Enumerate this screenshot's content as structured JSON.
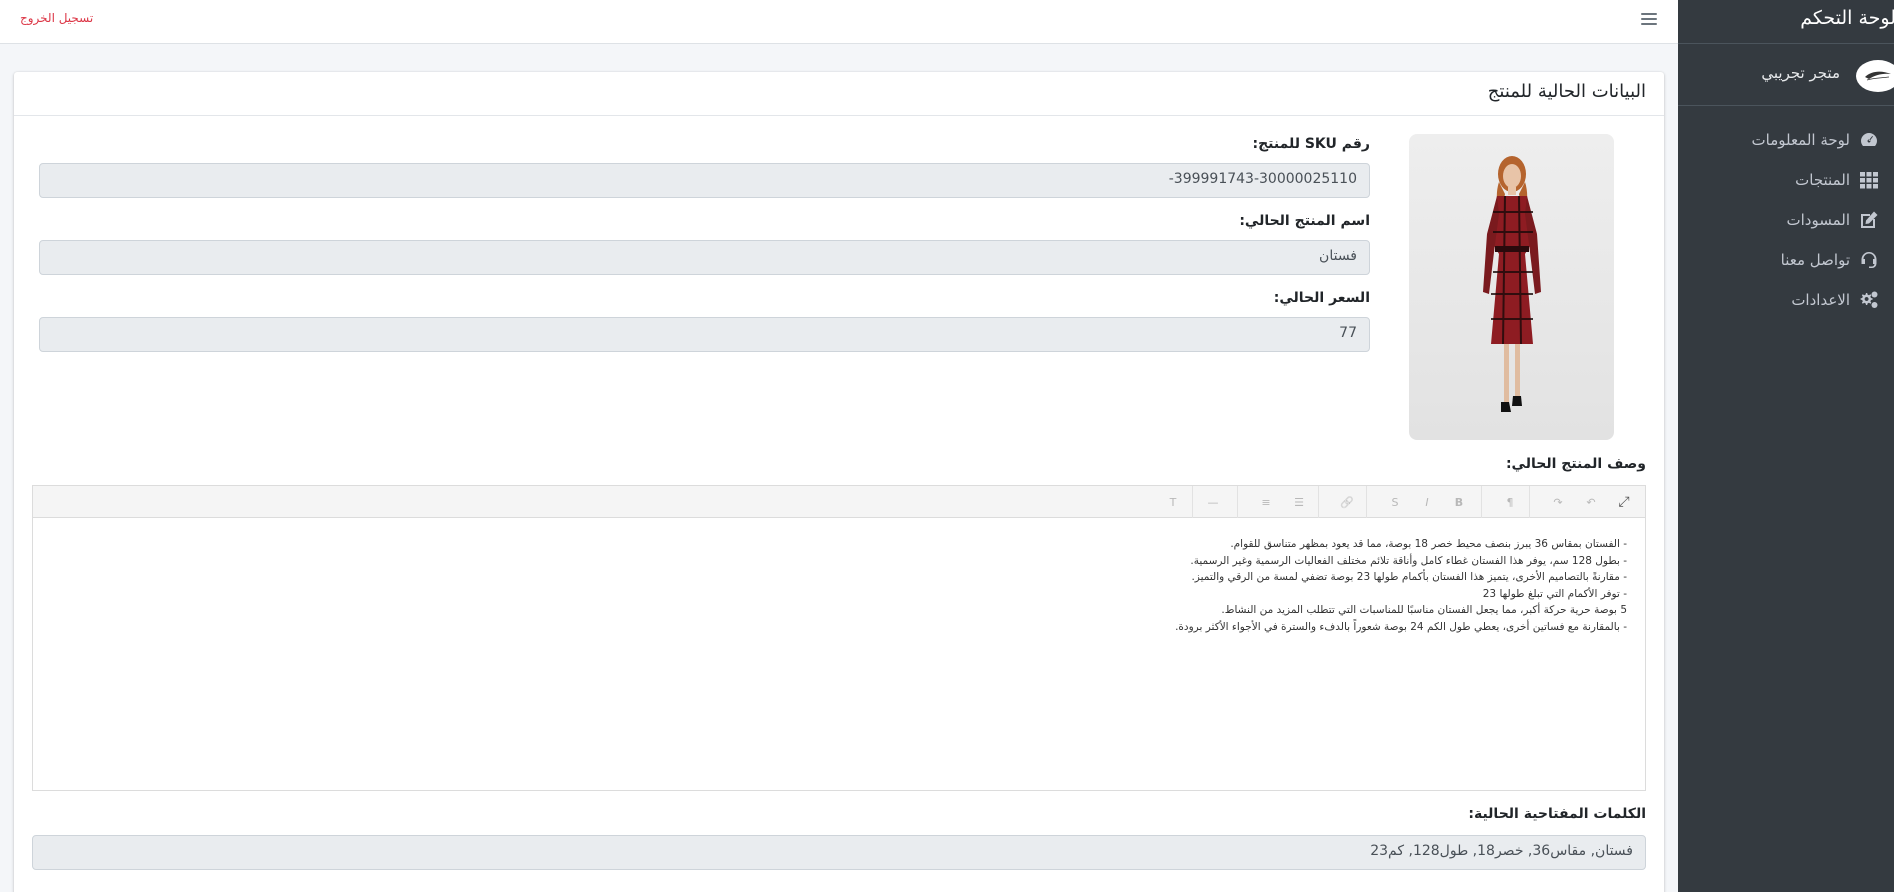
{
  "sidebar": {
    "brand": "لوحة التحكم",
    "user": {
      "name": "متجر تجريبي"
    },
    "items": [
      {
        "label": "لوحة المعلومات",
        "icon": "dashboard-icon"
      },
      {
        "label": "المنتجات",
        "icon": "grid-icon"
      },
      {
        "label": "المسودات",
        "icon": "edit-icon"
      },
      {
        "label": "تواصل معنا",
        "icon": "headset-icon"
      },
      {
        "label": "الاعدادات",
        "icon": "gears-icon"
      }
    ]
  },
  "topbar": {
    "logout": "تسجيل الخروج",
    "menu_icon": "hamburger-icon"
  },
  "card": {
    "title": "البيانات الحالية للمنتج",
    "sku_label": "رقم SKU للمنتج:",
    "sku_value": "399991743-30000025110-",
    "name_label": "اسم المنتج الحالي:",
    "name_value": "فستان",
    "price_label": "السعر الحالي:",
    "price_value": "77",
    "description_label": "وصف المنتج الحالي:",
    "description_lines": [
      "- الفستان بمقاس 36 يبرز بنصف محيط خصر 18 بوصة، مما قد يعود بمظهر متناسق للقوام.",
      "- بطول 128 سم، يوفر هذا الفستان غطاء كامل وأناقة تلائم مختلف الفعاليات الرسمية وغير الرسمية.",
      "- مقارنةً بالتصاميم الأخرى، يتميز هذا الفستان بأكمام طولها 23 بوصة تضفي لمسة من الرقي والتميز.",
      "- توفر الأكمام التي تبلغ طولها 23",
      "5 بوصة حرية حركة أكبر، مما يجعل الفستان مناسبًا للمناسبات التي تتطلب المزيد من النشاط.",
      "- بالمقارنة مع فساتين أخرى، يعطي طول الكم 24 بوصة شعوراً بالدفء والسترة في الأجواء الأكثر برودة."
    ],
    "keywords_label": "الكلمات المفتاحية الحالية:",
    "keywords_value": "فستان, مقاس36, خصر18, طول128, كم23"
  },
  "toolbar": {
    "buttons": [
      {
        "name": "fullscreen-icon",
        "glyph": "⤢"
      },
      {
        "name": "undo-icon",
        "glyph": "↶"
      },
      {
        "name": "redo-icon",
        "glyph": "↷"
      },
      {
        "name": "paragraph-style-icon",
        "glyph": "¶"
      },
      {
        "name": "bold-icon",
        "glyph": "B"
      },
      {
        "name": "italic-icon",
        "glyph": "I"
      },
      {
        "name": "strikethrough-icon",
        "glyph": "S"
      },
      {
        "name": "link-icon",
        "glyph": "🔗"
      },
      {
        "name": "unordered-list-icon",
        "glyph": "☰"
      },
      {
        "name": "ordered-list-icon",
        "glyph": "≡"
      },
      {
        "name": "horizontal-rule-icon",
        "glyph": "—"
      },
      {
        "name": "clear-format-icon",
        "glyph": "T"
      }
    ]
  },
  "colors": {
    "sidebar_bg": "#343a40",
    "logout": "#dc3545",
    "field_bg": "#e9ecef"
  }
}
